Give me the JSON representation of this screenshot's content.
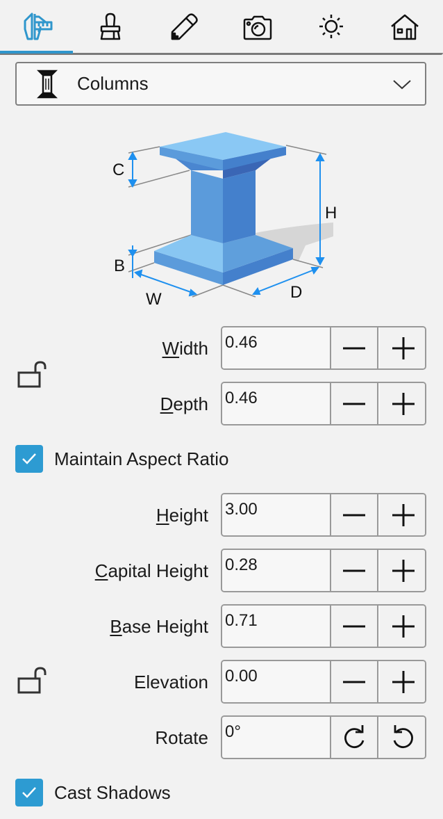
{
  "tabs": [
    {
      "id": "dimensions",
      "icon": "caliper-icon",
      "active": true
    },
    {
      "id": "style",
      "icon": "brush-icon",
      "active": false
    },
    {
      "id": "edit",
      "icon": "pencil-icon",
      "active": false
    },
    {
      "id": "camera",
      "icon": "camera-icon",
      "active": false
    },
    {
      "id": "lighting",
      "icon": "sun-icon",
      "active": false
    },
    {
      "id": "house",
      "icon": "house-icon",
      "active": false
    }
  ],
  "accent_color": "#2f96cc",
  "object_type": {
    "icon": "column-icon",
    "selected": "Columns"
  },
  "diagram": {
    "labels": {
      "c": "C",
      "h": "H",
      "b": "B",
      "w": "W",
      "d": "D"
    }
  },
  "fields": {
    "width": {
      "label_pre": "",
      "label_key": "W",
      "label_post": "idth",
      "value": "0.46"
    },
    "depth": {
      "label_pre": "",
      "label_key": "D",
      "label_post": "epth",
      "value": "0.46"
    },
    "height": {
      "label_pre": "",
      "label_key": "H",
      "label_post": "eight",
      "value": "3.00"
    },
    "capital_height": {
      "label_pre": "",
      "label_key": "C",
      "label_post": "apital Height",
      "value": "0.28"
    },
    "base_height": {
      "label_pre": "",
      "label_key": "B",
      "label_post": "ase Height",
      "value": "0.71"
    },
    "elevation": {
      "label": "Elevation",
      "value": "0.00"
    },
    "rotate": {
      "label": "Rotate",
      "value": "0°"
    }
  },
  "maintain_aspect_ratio": {
    "label": "Maintain Aspect Ratio",
    "checked": true
  },
  "cast_shadows": {
    "label": "Cast Shadows",
    "checked": true
  }
}
